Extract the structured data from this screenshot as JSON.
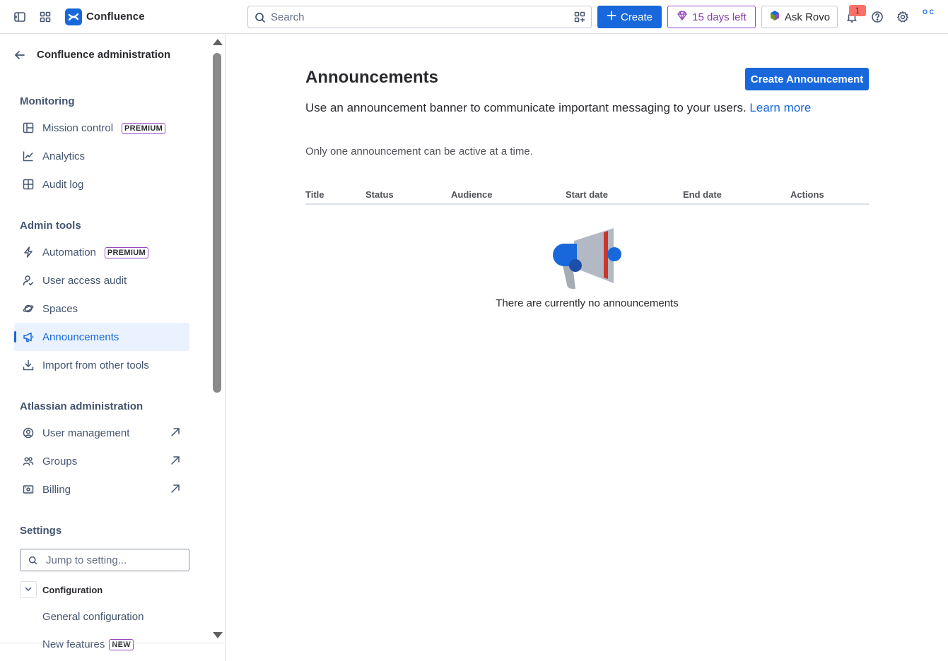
{
  "topbar": {
    "brand": "Confluence",
    "search_placeholder": "Search",
    "create_label": "Create",
    "trial_label": "15 days left",
    "rovo_label": "Ask Rovo",
    "notification_count": "1",
    "avatar_text": "O C"
  },
  "sidebar": {
    "title": "Confluence administration",
    "sections": {
      "monitoring": "Monitoring",
      "admin_tools": "Admin tools",
      "atlassian_admin": "Atlassian administration",
      "settings": "Settings"
    },
    "items": {
      "mission_control": "Mission control",
      "analytics": "Analytics",
      "audit_log": "Audit log",
      "automation": "Automation",
      "user_access_audit": "User access audit",
      "spaces": "Spaces",
      "announcements": "Announcements",
      "import": "Import from other tools",
      "user_management": "User management",
      "groups": "Groups",
      "billing": "Billing"
    },
    "premium_badge": "PREMIUM",
    "jump_placeholder": "Jump to setting...",
    "configuration_label": "Configuration",
    "config_items": {
      "general": "General configuration",
      "new_features": "New features",
      "new_badge": "NEW"
    }
  },
  "main": {
    "title": "Announcements",
    "create_button": "Create Announcement",
    "description": "Use an announcement banner to communicate important messaging to your users.",
    "learn_more": "Learn more",
    "note": "Only one announcement can be active at a time.",
    "columns": [
      "Title",
      "Status",
      "Audience",
      "Start date",
      "End date",
      "Actions"
    ],
    "empty_text": "There are currently no announcements"
  },
  "colors": {
    "brand_blue": "#1868db",
    "active_bg": "#e9f2fe",
    "premium_border": "#964ac0",
    "notif_badge": "#f87168"
  }
}
